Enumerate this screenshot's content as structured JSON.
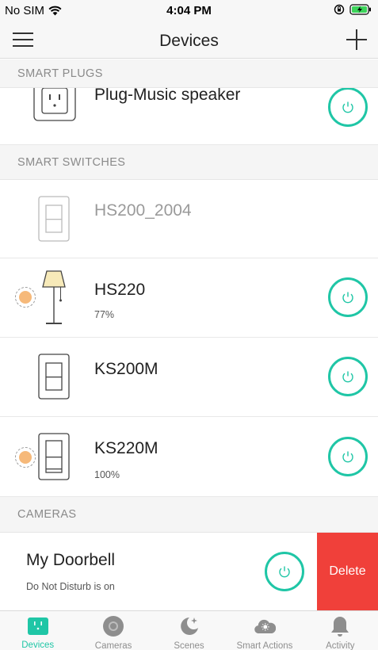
{
  "status_bar": {
    "carrier": "No SIM",
    "time": "4:04 PM"
  },
  "nav": {
    "title": "Devices"
  },
  "sections": {
    "smart_plugs": "SMART PLUGS",
    "smart_switches": "SMART SWITCHES",
    "cameras": "CAMERAS"
  },
  "devices": {
    "plug": {
      "name": "Plug-Music speaker"
    },
    "hs200": {
      "name": "HS200_2004"
    },
    "hs220": {
      "name": "HS220",
      "brightness": "77%"
    },
    "ks200m": {
      "name": "KS200M"
    },
    "ks220m": {
      "name": "KS220M",
      "brightness": "100%"
    }
  },
  "camera": {
    "name": "My Doorbell",
    "status": "Do Not Disturb is on",
    "delete_label": "Delete"
  },
  "tabs": [
    {
      "label": "Devices",
      "icon": "plug-icon",
      "active": true
    },
    {
      "label": "Cameras",
      "icon": "camera-lens-icon",
      "active": false
    },
    {
      "label": "Scenes",
      "icon": "moon-stars-icon",
      "active": false
    },
    {
      "label": "Smart Actions",
      "icon": "cloud-sun-icon",
      "active": false
    },
    {
      "label": "Activity",
      "icon": "bell-icon",
      "active": false
    }
  ],
  "colors": {
    "accent": "#1fc6a6",
    "delete": "#f0403a",
    "brightness_dot": "#f6b97a"
  }
}
